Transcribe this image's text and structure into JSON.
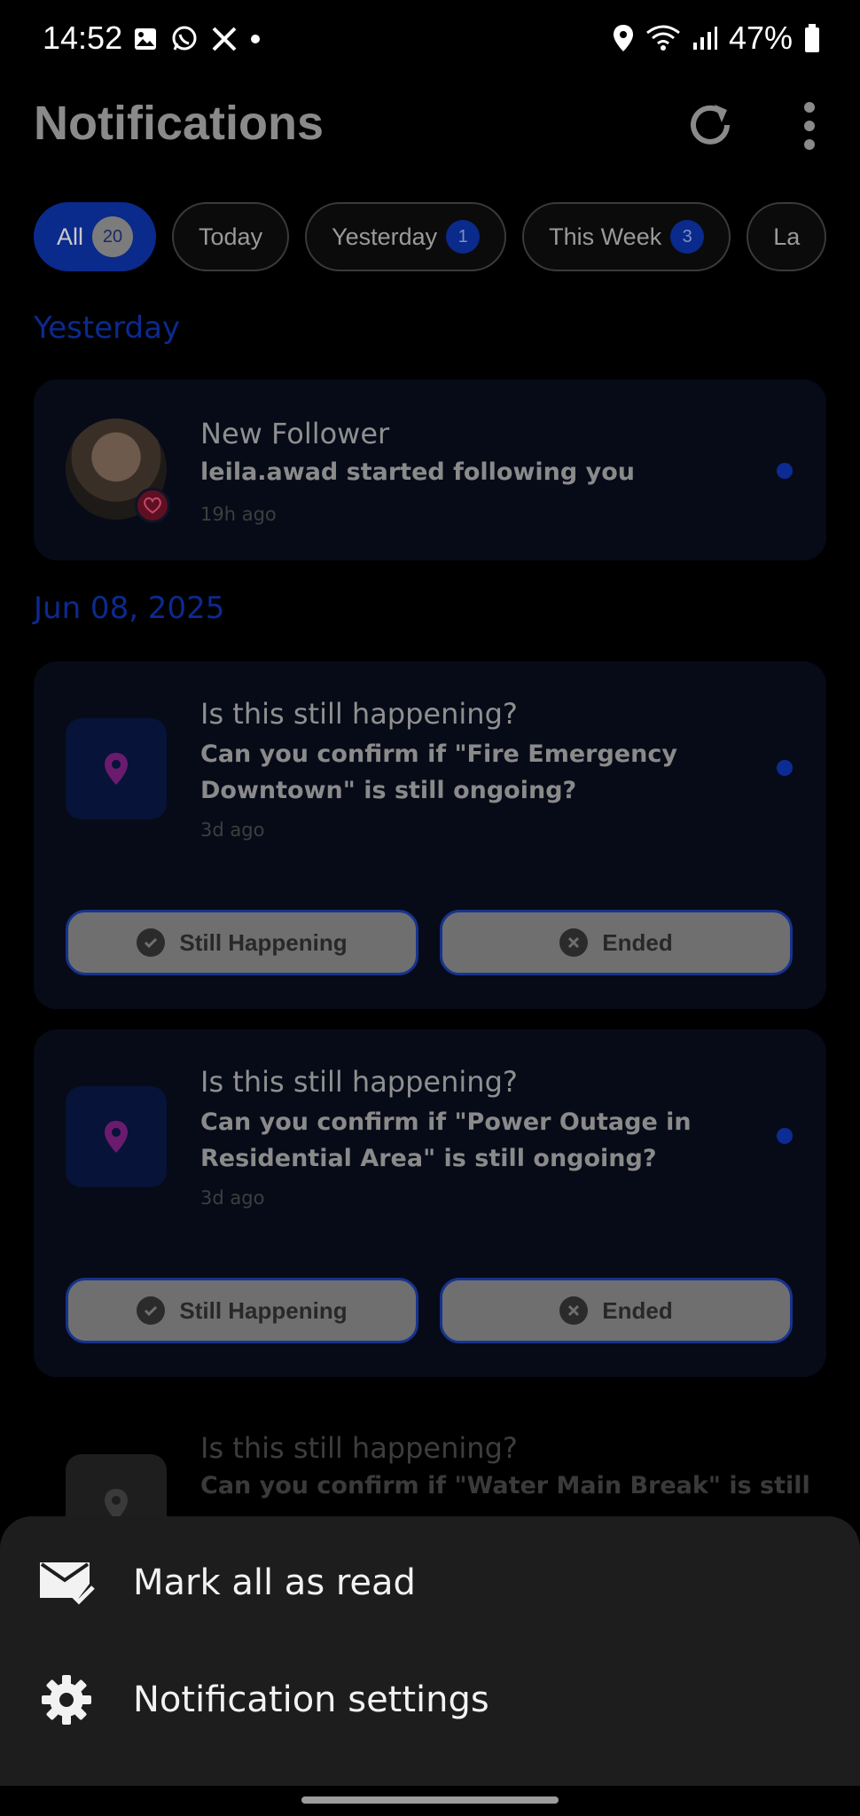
{
  "status_bar": {
    "time": "14:52",
    "battery": "47%",
    "left_icons": [
      "image-icon",
      "whatsapp-icon",
      "x-icon",
      "dot-icon"
    ],
    "right_icons": [
      "location-icon",
      "wifi-icon",
      "signal-icon",
      "battery-icon"
    ]
  },
  "header": {
    "title": "Notifications",
    "refresh_icon": "refresh-icon",
    "menu_icon": "more-vert-icon"
  },
  "filters": [
    {
      "label": "All",
      "count": "20",
      "active": true
    },
    {
      "label": "Today",
      "count": "",
      "active": false
    },
    {
      "label": "Yesterday",
      "count": "1",
      "active": false
    },
    {
      "label": "This Week",
      "count": "3",
      "active": false
    },
    {
      "label": "La",
      "count": "",
      "active": false
    }
  ],
  "sections": {
    "yesterday": "Yesterday",
    "jun": "Jun 08, 2025"
  },
  "follower": {
    "title": "New Follower",
    "body": "leila.awad started following you",
    "time": "19h ago"
  },
  "confirm1": {
    "title": "Is this still happening?",
    "body_line1": "Can you confirm if \"Fire Emergency",
    "body_line2": "Downtown\" is still ongoing?",
    "time": "3d ago",
    "yes": "Still Happening",
    "no": "Ended"
  },
  "confirm2": {
    "title": "Is this still happening?",
    "body_line1": "Can you confirm if \"Power Outage in",
    "body_line2": "Residential Area\" is still ongoing?",
    "time": "3d ago",
    "yes": "Still Happening",
    "no": "Ended"
  },
  "confirm3": {
    "title": "Is this still happening?",
    "body_line1": "Can you confirm if \"Water Main Break\" is still"
  },
  "sheet": {
    "mark_read": "Mark all as read",
    "settings": "Notification settings"
  },
  "colors": {
    "accent": "#0a2a8c",
    "card": "#070b18",
    "sheet": "#1d1d1d",
    "pin": "#6b1b6e"
  }
}
